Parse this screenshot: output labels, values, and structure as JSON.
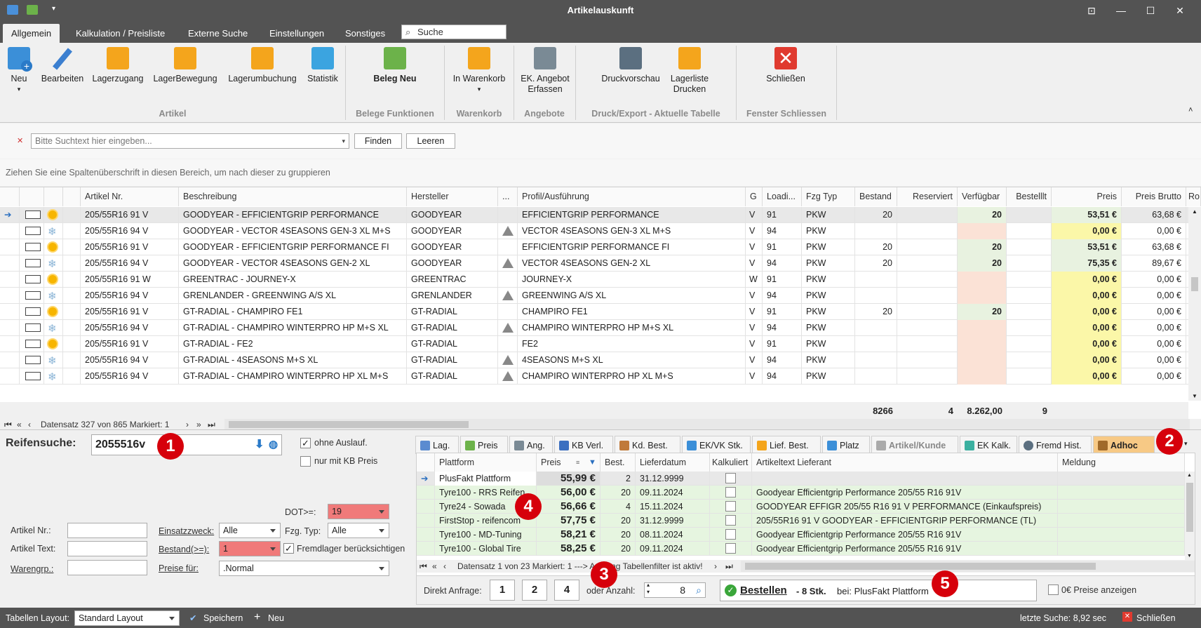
{
  "window": {
    "title": "Artikelauskunft"
  },
  "ribbon_tabs": [
    "Allgemein",
    "Kalkulation / Preisliste",
    "Externe Suche",
    "Einstellungen",
    "Sonstiges"
  ],
  "ribbon_search_placeholder": "Suche",
  "ribbon": {
    "neu": "Neu",
    "bearbeiten": "Bearbeiten",
    "lagerzugang": "Lagerzugang",
    "lagerbewegung": "LagerBewegung",
    "lagerumbuchung": "Lagerumbuchung",
    "statistik": "Statistik",
    "beleg_neu": "Beleg Neu",
    "in_warenkorb": "In Warenkorb",
    "ek_angebot_1": "EK. Angebot",
    "ek_angebot_2": "Erfassen",
    "druckvorschau": "Druckvorschau",
    "lagerliste_1": "Lagerliste",
    "lagerliste_2": "Drucken",
    "schliessen": "Schließen",
    "groups": [
      "Artikel",
      "Belege Funktionen",
      "Warenkorb",
      "Angebote",
      "Druck/Export - Aktuelle Tabelle",
      "Fenster Schliessen"
    ]
  },
  "filter": {
    "placeholder": "Bitte Suchtext hier eingeben...",
    "find": "Finden",
    "clear": "Leeren"
  },
  "group_hint": "Ziehen Sie eine Spaltenüberschrift in diesen Bereich, um nach dieser zu gruppieren",
  "grid": {
    "columns": [
      "Artikel Nr.",
      "Beschreibung",
      "Hersteller",
      "...",
      "Profil/Ausführung",
      "G",
      "Loadi...",
      "Fzg Typ",
      "Bestand",
      "Reserviert",
      "Verfügbar",
      "Bestelllt",
      "Preis",
      "Preis Brutto",
      "Ro"
    ],
    "rows": [
      {
        "art": "205/55R16 91 V",
        "desc": "GOODYEAR - EFFICIENTGRIP PERFORMANCE",
        "herst": "GOODYEAR",
        "profil": "EFFICIENTGRIP PERFORMANCE",
        "g": "V",
        "load": "91",
        "fzg": "PKW",
        "bestand": "20",
        "verf": "20",
        "preis": "53,51 €",
        "brutto": "63,68 €"
      },
      {
        "art": "205/55R16 94 V",
        "desc": "GOODYEAR - VECTOR 4SEASONS GEN-3 XL M+S",
        "herst": "GOODYEAR",
        "profil": "VECTOR 4SEASONS GEN-3 XL M+S",
        "g": "V",
        "load": "94",
        "fzg": "PKW",
        "bestand": "",
        "verf": "",
        "preis": "0,00 €",
        "brutto": "0,00 €"
      },
      {
        "art": "205/55R16 91 V",
        "desc": "GOODYEAR - EFFICIENTGRIP PERFORMANCE FI",
        "herst": "GOODYEAR",
        "profil": "EFFICIENTGRIP PERFORMANCE FI",
        "g": "V",
        "load": "91",
        "fzg": "PKW",
        "bestand": "20",
        "verf": "20",
        "preis": "53,51 €",
        "brutto": "63,68 €"
      },
      {
        "art": "205/55R16 94 V",
        "desc": "GOODYEAR - VECTOR 4SEASONS GEN-2 XL",
        "herst": "GOODYEAR",
        "profil": "VECTOR 4SEASONS GEN-2 XL",
        "g": "V",
        "load": "94",
        "fzg": "PKW",
        "bestand": "20",
        "verf": "20",
        "preis": "75,35 €",
        "brutto": "89,67 €"
      },
      {
        "art": "205/55R16 91 W",
        "desc": "GREENTRAC - JOURNEY-X",
        "herst": "GREENTRAC",
        "profil": "JOURNEY-X",
        "g": "W",
        "load": "91",
        "fzg": "PKW",
        "bestand": "",
        "verf": "",
        "preis": "0,00 €",
        "brutto": "0,00 €"
      },
      {
        "art": "205/55R16 94 V",
        "desc": "GRENLANDER - GREENWING A/S XL",
        "herst": "GRENLANDER",
        "profil": "GREENWING A/S XL",
        "g": "V",
        "load": "94",
        "fzg": "PKW",
        "bestand": "",
        "verf": "",
        "preis": "0,00 €",
        "brutto": "0,00 €"
      },
      {
        "art": "205/55R16 91 V",
        "desc": "GT-RADIAL - CHAMPIRO FE1",
        "herst": "GT-RADIAL",
        "profil": "CHAMPIRO FE1",
        "g": "V",
        "load": "91",
        "fzg": "PKW",
        "bestand": "20",
        "verf": "20",
        "preis": "0,00 €",
        "brutto": "0,00 €"
      },
      {
        "art": "205/55R16 94 V",
        "desc": "GT-RADIAL - CHAMPIRO WINTERPRO HP M+S XL",
        "herst": "GT-RADIAL",
        "profil": "CHAMPIRO WINTERPRO HP M+S XL",
        "g": "V",
        "load": "94",
        "fzg": "PKW",
        "bestand": "",
        "verf": "",
        "preis": "0,00 €",
        "brutto": "0,00 €"
      },
      {
        "art": "205/55R16 91 V",
        "desc": "GT-RADIAL - FE2",
        "herst": "GT-RADIAL",
        "profil": "FE2",
        "g": "V",
        "load": "91",
        "fzg": "PKW",
        "bestand": "",
        "verf": "",
        "preis": "0,00 €",
        "brutto": "0,00 €"
      },
      {
        "art": "205/55R16 94 V",
        "desc": "GT-RADIAL - 4SEASONS M+S XL",
        "herst": "GT-RADIAL",
        "profil": "4SEASONS M+S XL",
        "g": "V",
        "load": "94",
        "fzg": "PKW",
        "bestand": "",
        "verf": "",
        "preis": "0,00 €",
        "brutto": "0,00 €"
      },
      {
        "art": "205/55R16 94 V",
        "desc": "GT-RADIAL - CHAMPIRO WINTERPRO HP XL M+S",
        "herst": "GT-RADIAL",
        "profil": "CHAMPIRO WINTERPRO HP XL M+S",
        "g": "V",
        "load": "94",
        "fzg": "PKW",
        "bestand": "",
        "verf": "",
        "preis": "0,00 €",
        "brutto": "0,00 €"
      }
    ],
    "totals": {
      "bestand": "8266",
      "reserviert": "4",
      "verfuegbar": "8.262,00",
      "bestellt": "9"
    },
    "navigator": "Datensatz 327 von 865 Markiert: 1"
  },
  "search_panel": {
    "label": "Reifensuche:",
    "value": "2055516v",
    "ohne_auslauf": "ohne Auslauf.",
    "nur_kb": "nur mit KB Preis",
    "dot_label": "DOT>=:",
    "dot_value": "19",
    "artikel_nr": "Artikel Nr.:",
    "artikel_text": "Artikel Text:",
    "warengrp": "Warengrp.:",
    "einsatzzweck": "Einsatzzweck:",
    "einsatzzweck_value": "Alle",
    "fzg_typ": "Fzg. Typ:",
    "fzg_value": "Alle",
    "bestand": "Bestand(>=):",
    "bestand_value": "1",
    "fremdlager": "Fremdlager berücksichtigen",
    "preise_fuer": "Preise für:",
    "preise_value": ".Normal"
  },
  "bottom_tabs": [
    "Lag.",
    "Preis",
    "Ang.",
    "KB Verl.",
    "Kd. Best.",
    "EK/VK Stk.",
    "Lief. Best.",
    "Platz",
    "Artikel/Kunde",
    "EK Kalk.",
    "Fremd Hist.",
    "Adhoc"
  ],
  "supplier_grid": {
    "columns": [
      "Plattform",
      "Preis",
      "Best.",
      "Lieferdatum",
      "Kalkuliert",
      "Artikeltext Lieferant",
      "Meldung"
    ],
    "rows": [
      {
        "plattform": "PlusFakt Plattform",
        "preis": "55,99 €",
        "best": "2",
        "datum": "31.12.9999",
        "text": ""
      },
      {
        "plattform": "Tyre100 - RRS Reifen",
        "preis": "56,00 €",
        "best": "20",
        "datum": "09.11.2024",
        "text": "Goodyear Efficientgrip Performance 205/55 R16 91V"
      },
      {
        "plattform": "Tyre24 - Sowada",
        "preis": "56,66 €",
        "best": "4",
        "datum": "15.11.2024",
        "text": "GOODYEAR EFFIGR 205/55 R16 91 V PERFORMANCE (Einkaufspreis)"
      },
      {
        "plattform": "FirstStop - reifencom",
        "preis": "57,75 €",
        "best": "20",
        "datum": "31.12.9999",
        "text": "205/55R16 91 V GOODYEAR - EFFICIENTGRIP PERFORMANCE (TL)"
      },
      {
        "plattform": "Tyre100 - MD-Tuning",
        "preis": "58,21 €",
        "best": "20",
        "datum": "08.11.2024",
        "text": "Goodyear Efficientgrip Performance 205/55 R16 91V"
      },
      {
        "plattform": "Tyre100 - Global Tire",
        "preis": "58,25 €",
        "best": "20",
        "datum": "09.11.2024",
        "text": "Goodyear Efficientgrip Performance 205/55 R16 91V"
      }
    ],
    "navigator": "Datensatz 1 von 23 Markiert: 1 ---> Achtung Tabellenfilter ist aktiv!"
  },
  "order": {
    "direkt": "Direkt Anfrage:",
    "q1": "1",
    "q2": "2",
    "q3": "4",
    "oder": "oder Anzahl:",
    "anzahl": "8",
    "bestellen": "Bestellen",
    "stk": "- 8 Stk.",
    "bei": "bei: PlusFakt Plattform",
    "null_preise": "0€ Preise anzeigen"
  },
  "badges": [
    "1",
    "2",
    "3",
    "4",
    "5"
  ],
  "statusbar": {
    "layout_label": "Tabellen Layout:",
    "layout_value": "Standard Layout",
    "save": "Speichern",
    "new": "Neu",
    "last_search": "letzte Suche: 8,92 sec",
    "close": "Schließen"
  }
}
